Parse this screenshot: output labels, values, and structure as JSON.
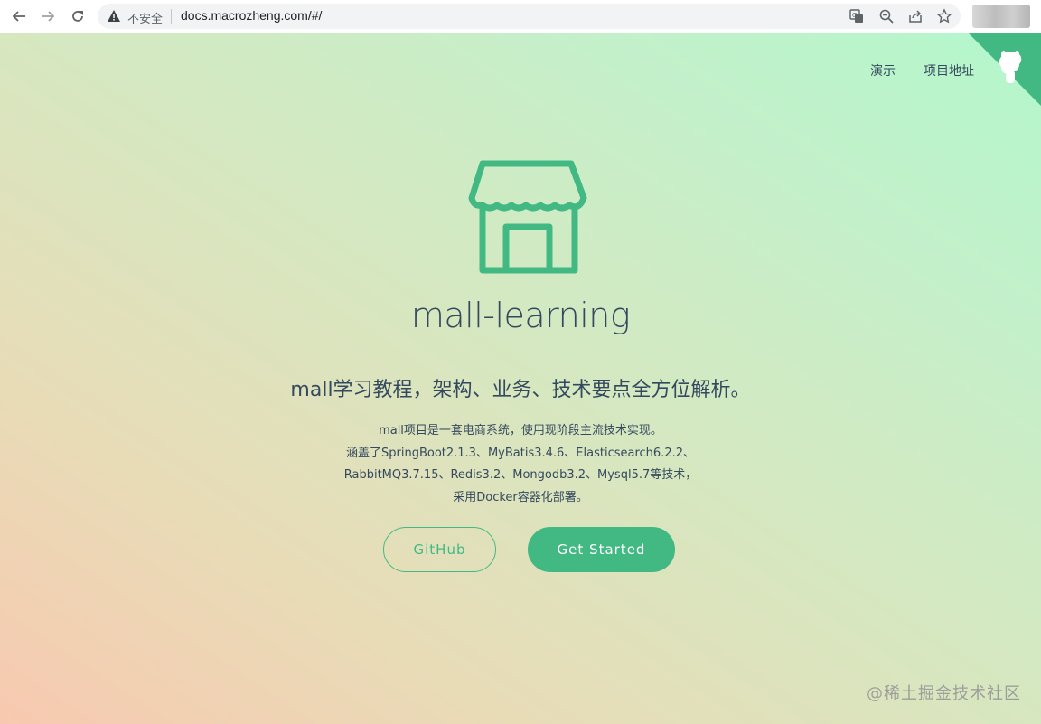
{
  "browser": {
    "security_label": "不安全",
    "url": "docs.macrozheng.com/#/"
  },
  "nav": {
    "items": [
      {
        "label": "演示"
      },
      {
        "label": "项目地址"
      }
    ]
  },
  "hero": {
    "title": "mall-learning",
    "tagline": "mall学习教程，架构、业务、技术要点全方位解析。",
    "description": [
      "mall项目是一套电商系统，使用现阶段主流技术实现。",
      "涵盖了SpringBoot2.1.3、MyBatis3.4.6、Elasticsearch6.2.2、",
      "RabbitMQ3.7.15、Redis3.2、Mongodb3.2、Mysql5.7等技术，",
      "采用Docker容器化部署。"
    ],
    "buttons": {
      "github": "GitHub",
      "get_started": "Get Started"
    }
  },
  "watermark": "@稀土掘金技术社区",
  "colors": {
    "accent": "#42b983",
    "text": "#34495e"
  },
  "icons": [
    "back-icon",
    "forward-icon",
    "reload-icon",
    "warning-icon",
    "translate-icon",
    "zoom-icon",
    "share-icon",
    "bookmark-star-icon",
    "store-logo-icon",
    "github-corner-icon"
  ]
}
